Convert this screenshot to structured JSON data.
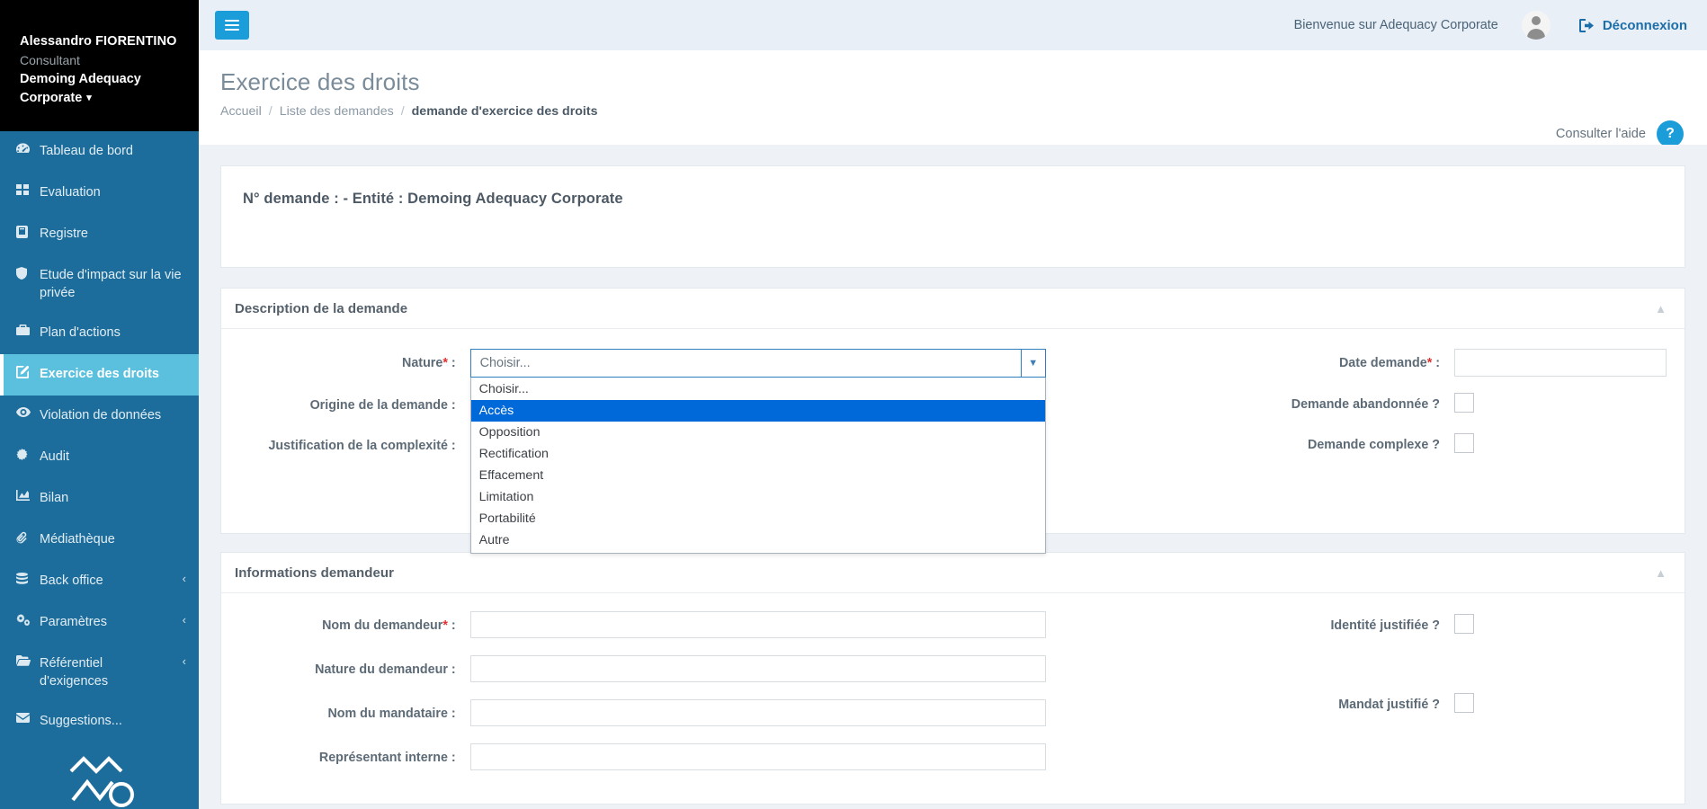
{
  "sidebar": {
    "user": {
      "name": "Alessandro FIORENTINO",
      "role": "Consultant",
      "org": "Demoing Adequacy Corporate",
      "caret": "chevron-down"
    },
    "items": [
      {
        "label": "Tableau de bord",
        "icon": "dashboard-icon",
        "active": false,
        "arrow": ""
      },
      {
        "label": "Evaluation",
        "icon": "grid-icon",
        "active": false,
        "arrow": ""
      },
      {
        "label": "Registre",
        "icon": "book-icon",
        "active": false,
        "arrow": ""
      },
      {
        "label": "Etude d'impact sur la vie privée",
        "icon": "shield-icon",
        "active": false,
        "arrow": ""
      },
      {
        "label": "Plan d'actions",
        "icon": "briefcase-icon",
        "active": false,
        "arrow": ""
      },
      {
        "label": "Exercice des droits",
        "icon": "edit-icon",
        "active": true,
        "arrow": ""
      },
      {
        "label": "Violation de données",
        "icon": "eye-icon",
        "active": false,
        "arrow": ""
      },
      {
        "label": "Audit",
        "icon": "gear-icon",
        "active": false,
        "arrow": ""
      },
      {
        "label": "Bilan",
        "icon": "chart-icon",
        "active": false,
        "arrow": ""
      },
      {
        "label": "Médiathèque",
        "icon": "paperclip-icon",
        "active": false,
        "arrow": ""
      },
      {
        "label": "Back office",
        "icon": "database-icon",
        "active": false,
        "arrow": "‹"
      },
      {
        "label": "Paramètres",
        "icon": "cogs-icon",
        "active": false,
        "arrow": "‹"
      },
      {
        "label": "Référentiel d'exigences",
        "icon": "folder-open-icon",
        "active": false,
        "arrow": "‹"
      },
      {
        "label": "Suggestions...",
        "icon": "envelope-icon",
        "active": false,
        "arrow": ""
      }
    ]
  },
  "topbar": {
    "menu_toggle": "hamburger-icon",
    "welcome": "Bienvenue sur Adequacy Corporate",
    "avatar": "user-avatar",
    "logout": "Déconnexion"
  },
  "page": {
    "title": "Exercice des droits",
    "breadcrumb": {
      "home": "Accueil",
      "list": "Liste des demandes",
      "current": "demande d'exercice des droits",
      "separator": "/"
    },
    "help": {
      "label": "Consulter l'aide",
      "badge": "?"
    }
  },
  "banner": {
    "text": "N° demande : - Entité : Demoing Adequacy Corporate"
  },
  "sections": {
    "description": {
      "title": "Description de la demande",
      "toggle": "chevron-up",
      "fields": {
        "nature_label": "Nature",
        "nature_required": "*",
        "nature_suffix": " :",
        "nature_value": "Choisir...",
        "nature_options": [
          "Choisir...",
          "Accès",
          "Opposition",
          "Rectification",
          "Effacement",
          "Limitation",
          "Portabilité",
          "Autre"
        ],
        "nature_selected_index": 1,
        "origine_label": "Origine de la demande :",
        "origine_value": "",
        "justification_label": "Justification de la complexité :",
        "justification_value": "",
        "date_label": "Date demande",
        "date_required": "*",
        "date_suffix": " :",
        "date_value": "",
        "abandonnee_label": "Demande abandonnée ?",
        "abandonnee_checked": false,
        "complexe_label": "Demande complexe ?",
        "complexe_checked": false
      }
    },
    "demandeur": {
      "title": "Informations demandeur",
      "toggle": "chevron-up",
      "fields": {
        "nom_label": "Nom du demandeur",
        "nom_required": "*",
        "nom_suffix": " :",
        "nom_value": "",
        "nature_label": "Nature du demandeur :",
        "nature_value": "",
        "mandataire_label": "Nom du mandataire :",
        "mandataire_value": "",
        "representant_label": "Représentant interne :",
        "representant_value": "",
        "identite_label": "Identité justifiée ?",
        "identite_checked": false,
        "mandat_label": "Mandat justifié ?",
        "mandat_checked": false
      }
    }
  },
  "colors": {
    "sidebar_bg": "#1d6d9c",
    "sidebar_user_bg": "#000000",
    "sidebar_active": "#5bc0de",
    "accent": "#1b9dd9",
    "topbar_bg": "#e9eff6",
    "content_bg": "#eef2f7",
    "option_selected": "#0069d9",
    "required": "#e03030"
  }
}
